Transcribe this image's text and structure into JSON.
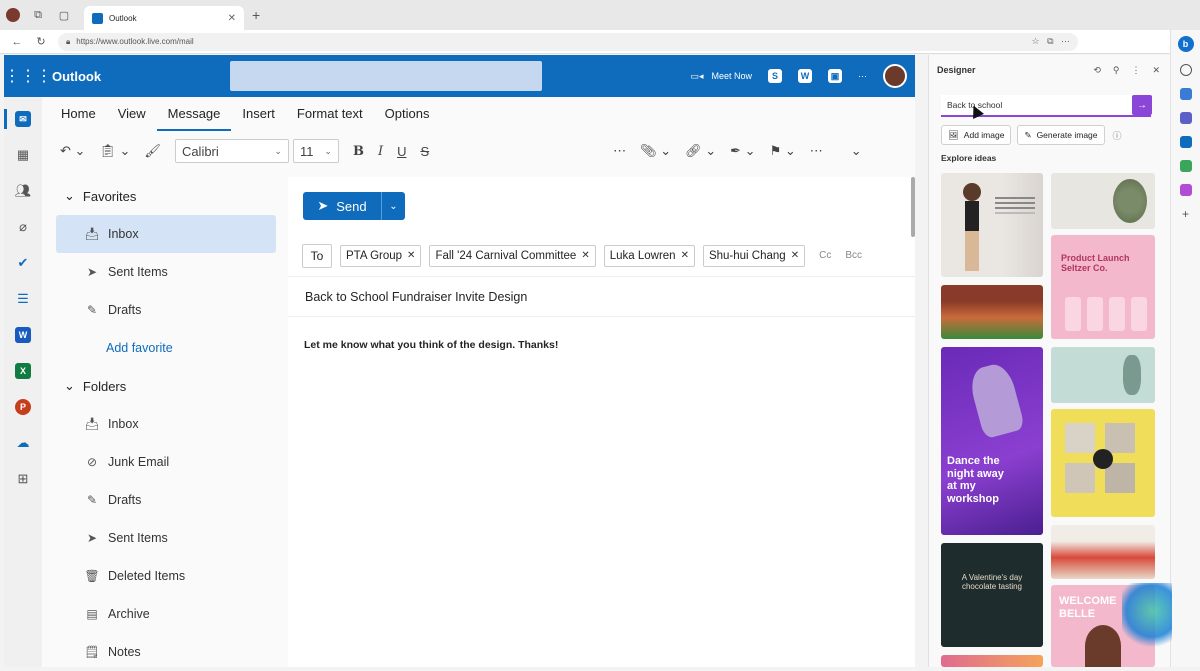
{
  "browser": {
    "tab_title": "Outlook",
    "url": "https://www.outlook.live.com/mail"
  },
  "header": {
    "brand": "Outlook",
    "meet_now": "Meet Now"
  },
  "ribbon": {
    "tabs": [
      "Home",
      "View",
      "Message",
      "Insert",
      "Format text",
      "Options"
    ],
    "active_tab": "Message",
    "font": "Calibri",
    "size": "11"
  },
  "folders": {
    "favorites_label": "Favorites",
    "favorites": [
      "Inbox",
      "Sent Items",
      "Drafts"
    ],
    "add_favorite": "Add favorite",
    "folders_label": "Folders",
    "folders": [
      "Inbox",
      "Junk Email",
      "Drafts",
      "Sent Items",
      "Deleted Items",
      "Archive",
      "Notes"
    ]
  },
  "compose": {
    "send_label": "Send",
    "to_label": "To",
    "recipients": [
      "PTA Group",
      "Fall '24 Carnival Committee",
      "Luka Lowren",
      "Shu-hui Chang"
    ],
    "cc_label": "Cc",
    "bcc_label": "Bcc",
    "subject": "Back to School Fundraiser Invite Design",
    "body": "Let me know what you think of the design. Thanks!"
  },
  "designer": {
    "title": "Designer",
    "search_value": "Back to school",
    "add_image": "Add image",
    "generate_image": "Generate image",
    "explore_label": "Explore ideas",
    "tile_texts": {
      "dance": "Dance the night away at my workshop",
      "product": "Product Launch Seltzer Co.",
      "valentine": "A Valentine's day chocolate tasting",
      "welcome": "WELCOME BELLE"
    }
  },
  "colors": {
    "brand_blue": "#0f6cbd",
    "designer_purple": "#8a46d6"
  }
}
